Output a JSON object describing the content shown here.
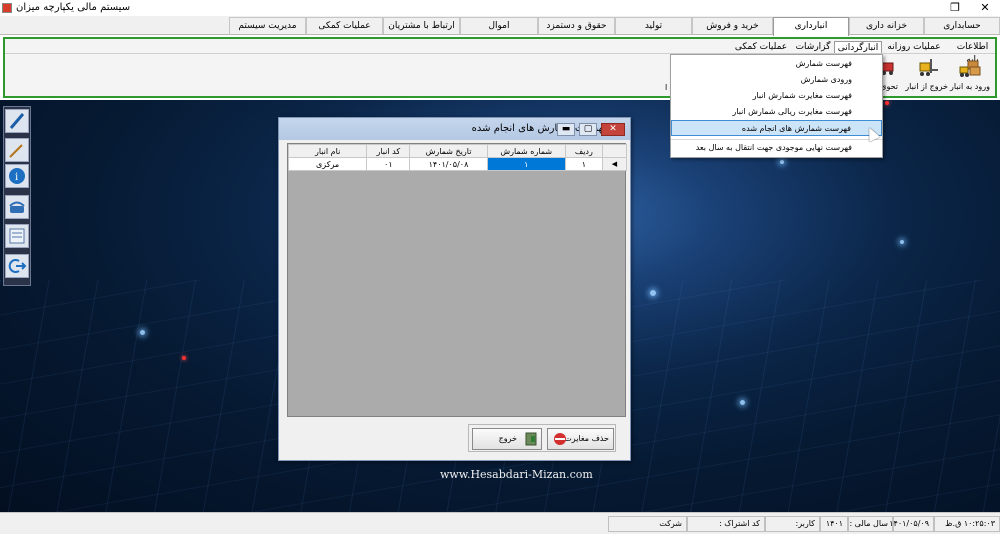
{
  "window": {
    "title": "سیستم مالی یکپارچه میزان"
  },
  "modules": [
    "حسابداری",
    "خزانه داری",
    "انبارداری",
    "خرید و فروش",
    "تولید",
    "حقوق و دستمزد",
    "اموال",
    "ارتباط با مشتریان",
    "عملیات کمکی",
    "مدیریت سیستم"
  ],
  "ribbon": {
    "tabs": [
      "اطلاعات پایه",
      "عملیات روزانه",
      "انبارگردانی",
      "گزارشات",
      "عملیات کمکی"
    ],
    "buttons": [
      "ورود به انبار",
      "خروج از انبار",
      "تحوی"
    ],
    "fragment": "ا"
  },
  "dropdown": {
    "items": [
      "فهرست شمارش",
      "ورودی شمارش",
      "فهرست مغایرت شمارش انبار",
      "فهرست مغایرت ریالی شمارش انبار",
      "فهرست شمارش های انجام شده",
      "فهرست نهایی موجودی جهت انتقال به سال بعد"
    ],
    "highlighted_index": 4
  },
  "dialog": {
    "title": "فهرست شمارش های انجام شده",
    "columns": [
      "ردیف",
      "شماره شمارش",
      "تاریخ شمارش",
      "کد انبار",
      "نام انبار"
    ],
    "rows": [
      [
        "۱",
        "۱",
        "۱۴۰۱/۰۵/۰۸",
        "۰۱",
        "مرکزی"
      ]
    ],
    "delete_button": "حذف مغایرت",
    "exit_button": "خروج"
  },
  "website": "www.Hesabdari-Mizan.com",
  "statusbar": {
    "time": "۱۰:۲۵:۰۳ ق.ظ",
    "date": "۱۴۰۱/۰۵/۰۹",
    "fiscal_year_label": "سال مالی :",
    "fiscal_year": "۱۴۰۱",
    "user_label": "کاربر:",
    "subscription_label": "کد اشتراک :",
    "company_label": "شرکت"
  }
}
